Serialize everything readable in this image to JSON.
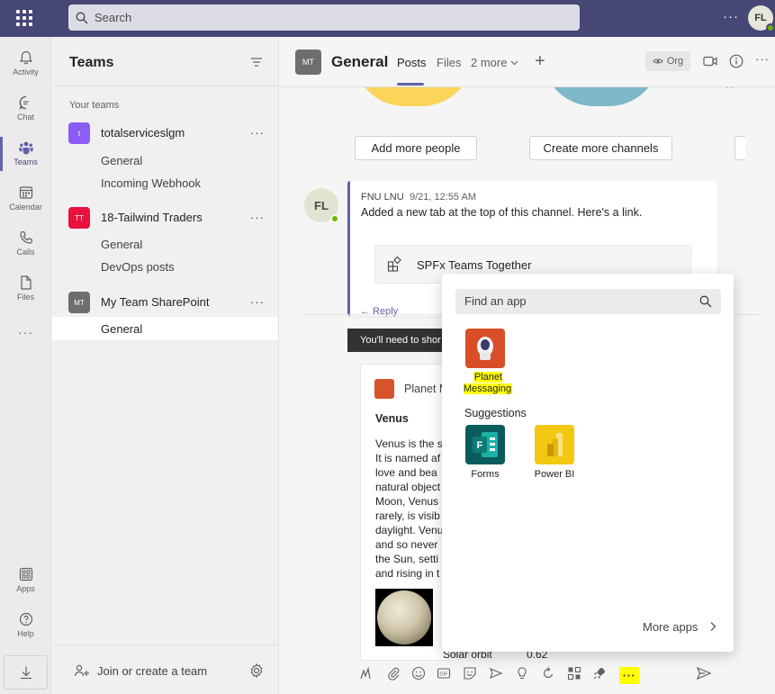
{
  "topbar": {
    "search_placeholder": "Search",
    "more": "···",
    "avatar_initials": "FL"
  },
  "rail": {
    "items": [
      {
        "label": "Activity",
        "icon": "bell-icon"
      },
      {
        "label": "Chat",
        "icon": "chat-icon"
      },
      {
        "label": "Teams",
        "icon": "teams-icon",
        "active": true
      },
      {
        "label": "Calendar",
        "icon": "calendar-icon"
      },
      {
        "label": "Calls",
        "icon": "phone-icon"
      },
      {
        "label": "Files",
        "icon": "file-icon"
      }
    ],
    "more": "···",
    "apps_label": "Apps",
    "help_label": "Help"
  },
  "panel": {
    "title": "Teams",
    "section_label": "Your teams",
    "teams": [
      {
        "initials": "t",
        "name": "totalserviceslgm",
        "color": "#8b5cf6",
        "channels": [
          "General",
          "Incoming Webhook"
        ]
      },
      {
        "initials": "TT",
        "name": "18-Tailwind Traders",
        "color": "#e8123d",
        "channels": [
          "General",
          "DevOps posts"
        ]
      },
      {
        "initials": "MT",
        "name": "My Team SharePoint",
        "color": "#6e6e6e",
        "channels": [
          "General"
        ]
      }
    ],
    "team_more": "···",
    "join_label": "Join or create a team"
  },
  "header": {
    "avatar_initials": "MT",
    "title": "General",
    "tabs": [
      "Posts",
      "Files",
      "2 more"
    ],
    "plus": "+",
    "org_label": "Org",
    "more": "···"
  },
  "welcome": {
    "add_people": "Add more people",
    "create_channels": "Create more channels"
  },
  "post": {
    "avatar_initials": "FL",
    "author": "FNU LNU",
    "time": "9/21, 12:55 AM",
    "text": "Added a new tab at the top of this channel. Here's a link.",
    "tab_title": "SPFx Teams Together",
    "reply": "← Reply"
  },
  "notice": {
    "text": "You'll need to shor"
  },
  "card": {
    "title": "Planet M",
    "heading": "Venus",
    "body_lines": [
      "Venus is the s",
      "It is named af",
      "love and bea",
      "natural object",
      "Moon, Venus",
      "rarely, is visib",
      "daylight. Venu",
      "and so never",
      "the Sun, setti",
      "and rising in t"
    ],
    "fact_label": "Solar orbit",
    "fact_value": "0.62"
  },
  "flyout": {
    "search_placeholder": "Find an app",
    "installed_app": "Planet Messaging",
    "suggestions_label": "Suggestions",
    "suggested_apps": [
      "Forms",
      "Power BI"
    ],
    "more_apps": "More apps"
  },
  "compose": {
    "more": "···"
  },
  "colors": {
    "topbar": "#464775",
    "accent": "#6264a7",
    "highlight": "#ffff00",
    "presence": "#6bb700"
  }
}
